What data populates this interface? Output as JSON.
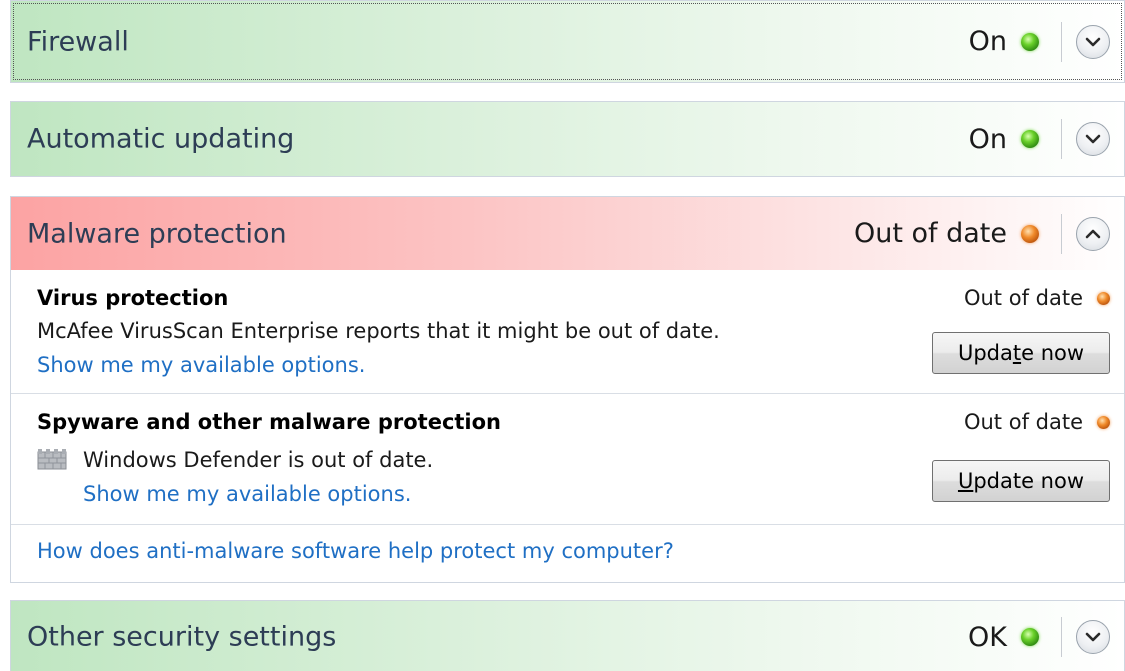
{
  "colors": {
    "ok": "#4cc02a",
    "warning": "#e07a1f",
    "link": "#1f6fc4"
  },
  "sections": {
    "firewall": {
      "title": "Firewall",
      "status": "On",
      "status_icon": "green-status-icon",
      "expand_icon": "chevron-down-icon"
    },
    "updating": {
      "title": "Automatic updating",
      "status": "On",
      "status_icon": "green-status-icon",
      "expand_icon": "chevron-down-icon"
    },
    "malware": {
      "title": "Malware protection",
      "status": "Out of date",
      "status_icon": "orange-status-icon",
      "expand_icon": "chevron-up-icon",
      "virus": {
        "title": "Virus protection",
        "description": "McAfee VirusScan Enterprise reports that it might be out of date.",
        "link": "Show me my available options.",
        "status": "Out of date",
        "button": {
          "pre": "Upda",
          "accel": "t",
          "post": "e now"
        }
      },
      "spyware": {
        "title": "Spyware and other malware protection",
        "description": "Windows Defender is out of date.",
        "link": "Show me my available options.",
        "status": "Out of date",
        "icon": "windows-defender-icon",
        "button": {
          "pre": "",
          "accel": "U",
          "post": "pdate now"
        }
      },
      "help_link": "How does anti-malware software help protect my computer?"
    },
    "other": {
      "title": "Other security settings",
      "status": "OK",
      "status_icon": "green-status-icon",
      "expand_icon": "chevron-down-icon"
    }
  }
}
